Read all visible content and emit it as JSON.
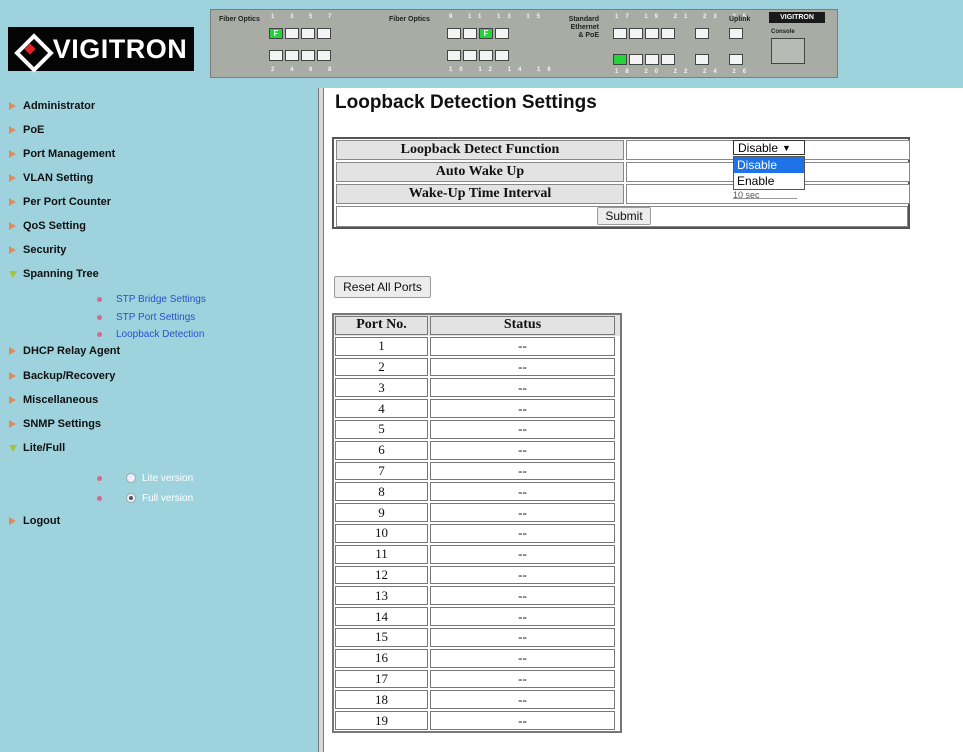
{
  "header": {
    "logo_text": "VIGITRON",
    "switch": {
      "group1_label": "Fiber Optics",
      "group1_top_nums": "1 3 5 7",
      "group1_bottom_nums": "2 4 6 8",
      "group2_label": "Fiber Optics",
      "group2_top_nums": "9 11 13 15",
      "group2_bottom_nums": "10 12 14 16",
      "group3_label": "Standard Ethernet & PoE",
      "group3_top_nums": "17 19 21 23 25",
      "group3_bottom_nums": "18 20 22 24 26",
      "uplink_label": "Uplink",
      "brand": "VIGITRON",
      "console_label": "Console",
      "port_marker": "F"
    }
  },
  "sidebar": {
    "items": [
      {
        "label": "Administrator"
      },
      {
        "label": "PoE"
      },
      {
        "label": "Port Management"
      },
      {
        "label": "VLAN Setting"
      },
      {
        "label": "Per Port Counter"
      },
      {
        "label": "QoS Setting"
      },
      {
        "label": "Security"
      },
      {
        "label": "Spanning Tree"
      },
      {
        "label": "DHCP Relay Agent"
      },
      {
        "label": "Backup/Recovery"
      },
      {
        "label": "Miscellaneous"
      },
      {
        "label": "SNMP Settings"
      },
      {
        "label": "Lite/Full"
      },
      {
        "label": "Logout"
      }
    ],
    "spanning_tree_sub": [
      {
        "label": "STP Bridge Settings"
      },
      {
        "label": "STP Port Settings"
      },
      {
        "label": "Loopback Detection"
      }
    ],
    "version_options": [
      {
        "label": "Lite version",
        "checked": false
      },
      {
        "label": "Full version",
        "checked": true
      }
    ]
  },
  "main": {
    "title": "Loopback Detection Settings",
    "settings": {
      "loopback_label": "Loopback Detect Function",
      "auto_wake_label": "Auto Wake Up",
      "interval_label": "Wake-Up Time Interval",
      "select_value": "Disable",
      "options": [
        "Disable",
        "Enable"
      ],
      "interval_peek": "10 sec",
      "submit_label": "Submit"
    },
    "reset_label": "Reset All Ports",
    "port_table": {
      "headers": [
        "Port No.",
        "Status"
      ],
      "rows": [
        [
          "1",
          "--"
        ],
        [
          "2",
          "--"
        ],
        [
          "3",
          "--"
        ],
        [
          "4",
          "--"
        ],
        [
          "5",
          "--"
        ],
        [
          "6",
          "--"
        ],
        [
          "7",
          "--"
        ],
        [
          "8",
          "--"
        ],
        [
          "9",
          "--"
        ],
        [
          "10",
          "--"
        ],
        [
          "11",
          "--"
        ],
        [
          "12",
          "--"
        ],
        [
          "13",
          "--"
        ],
        [
          "14",
          "--"
        ],
        [
          "15",
          "--"
        ],
        [
          "16",
          "--"
        ],
        [
          "17",
          "--"
        ],
        [
          "18",
          "--"
        ],
        [
          "19",
          "--"
        ]
      ]
    }
  }
}
